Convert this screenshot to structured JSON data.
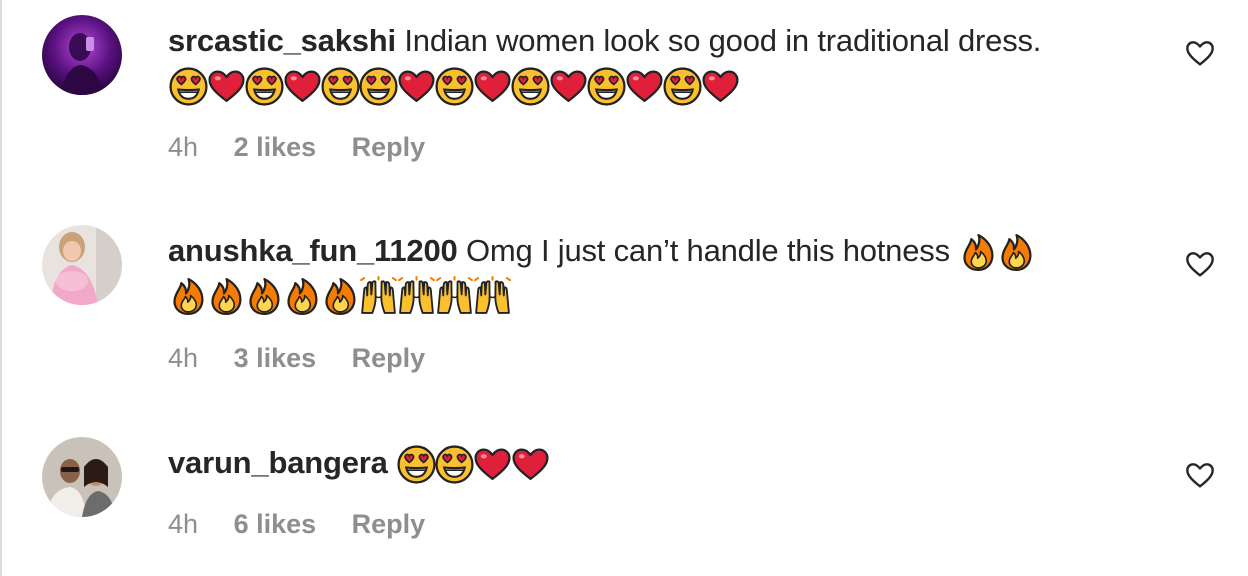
{
  "comments": [
    {
      "username": "srcastic_sakshi",
      "text": "Indian women look so good in traditional dress.",
      "emojis_line1": [],
      "emojis_line2": [
        "heart-eyes",
        "heart",
        "heart-eyes",
        "heart",
        "heart-eyes",
        "heart-eyes",
        "heart",
        "heart-eyes",
        "heart",
        "heart-eyes",
        "heart",
        "heart-eyes",
        "heart",
        "heart-eyes",
        "heart"
      ],
      "time": "4h",
      "likes": "2 likes",
      "reply": "Reply"
    },
    {
      "username": "anushka_fun_11200",
      "text": "Omg I just can’t handle this hotness",
      "emojis_line1": [
        "fire",
        "fire"
      ],
      "emojis_line2": [
        "fire",
        "fire",
        "fire",
        "fire",
        "fire",
        "raising-hands",
        "raising-hands",
        "raising-hands",
        "raising-hands"
      ],
      "time": "4h",
      "likes": "3 likes",
      "reply": "Reply"
    },
    {
      "username": "varun_bangera",
      "text": "",
      "emojis_line1": [
        "heart-eyes",
        "heart-eyes",
        "heart",
        "heart"
      ],
      "emojis_line2": [],
      "time": "4h",
      "likes": "6 likes",
      "reply": "Reply"
    }
  ],
  "colors": {
    "text": "#262626",
    "meta": "#8e8e8e",
    "heart_red": "#e0203a",
    "emoji_yellow": "#fbc02d",
    "fire_orange": "#f57c00"
  },
  "icons": {
    "like": "heart-outline-icon"
  }
}
